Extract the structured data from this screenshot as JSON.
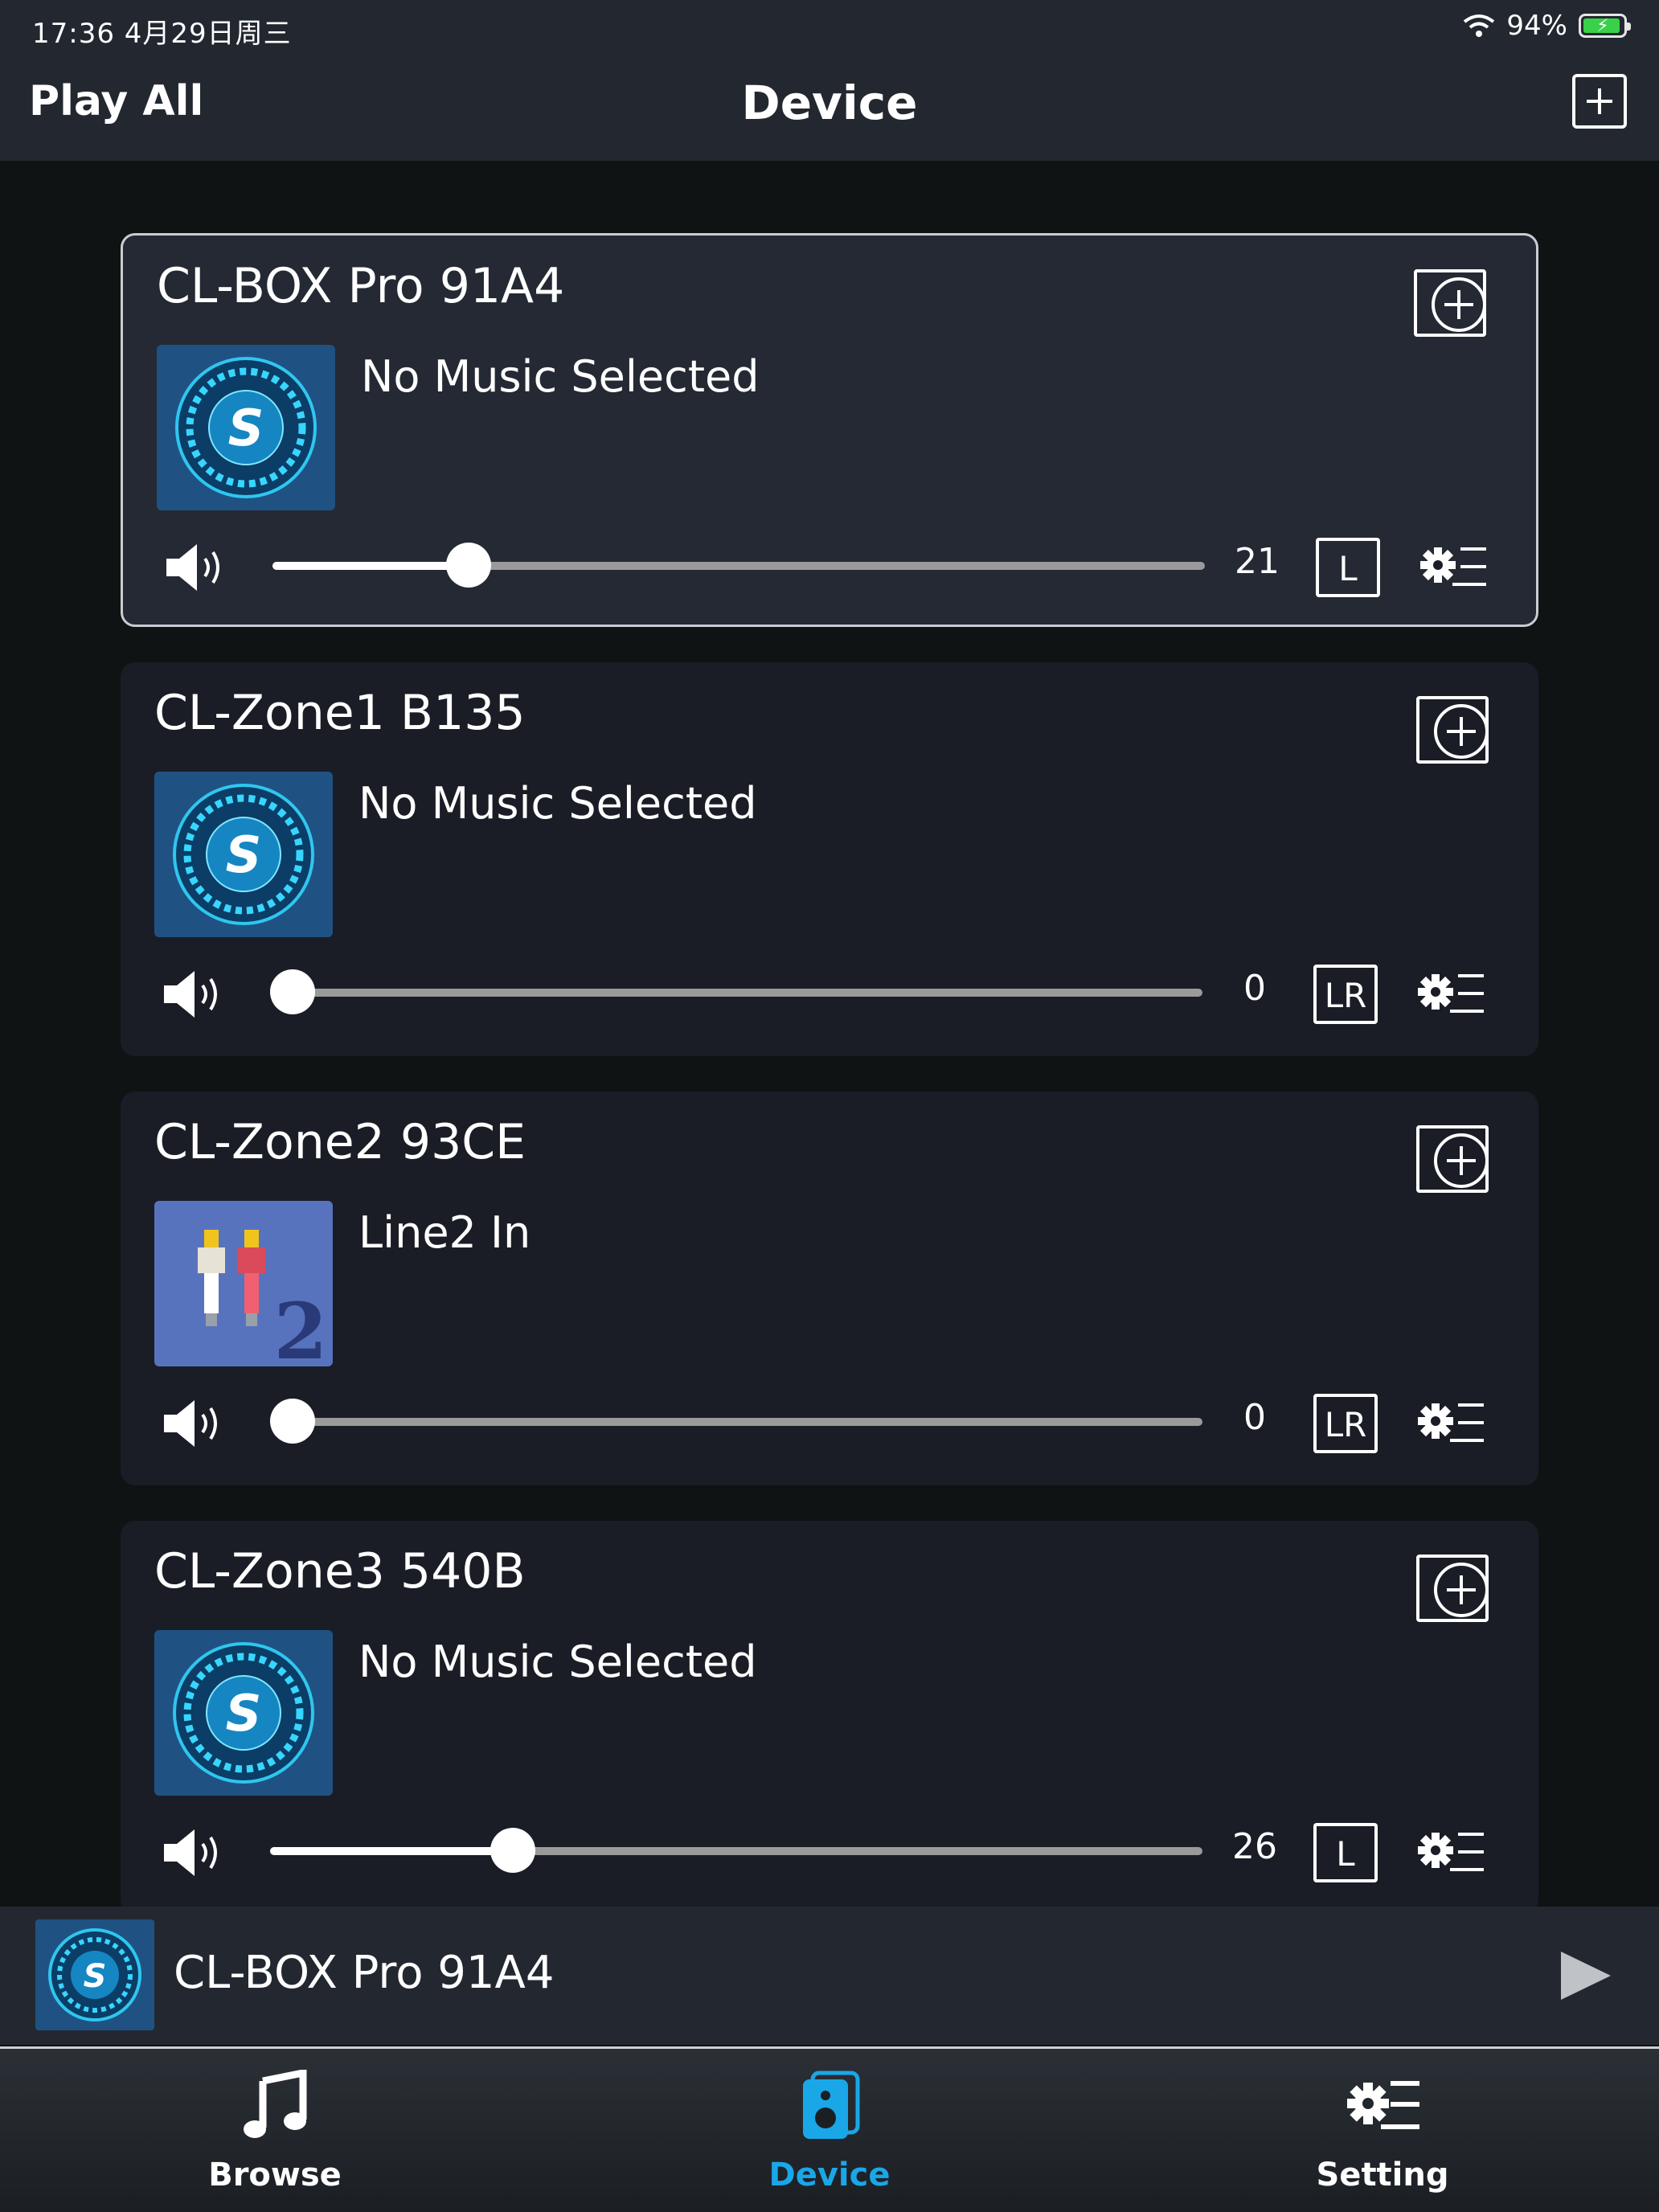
{
  "status_bar": {
    "time_date": "17:36   4月29日周三",
    "battery": "94%",
    "battery_level": 0.94
  },
  "nav": {
    "left_label": "Play All",
    "title": "Device"
  },
  "devices": [
    {
      "name": "CL-BOX Pro 91A4",
      "source": "No Music Selected",
      "cover": "app-logo",
      "volume": 21,
      "volume_fraction": 0.21,
      "channel": "L",
      "selected": true
    },
    {
      "name": "CL-Zone1 B135",
      "source": "No Music Selected",
      "cover": "app-logo",
      "volume": 0,
      "volume_fraction": 0.0,
      "channel": "LR",
      "selected": false
    },
    {
      "name": "CL-Zone2 93CE",
      "source": "Line2 In",
      "cover": "line-in-2",
      "volume": 0,
      "volume_fraction": 0.0,
      "channel": "LR",
      "selected": false
    },
    {
      "name": "CL-Zone3 540B",
      "source": "No Music Selected",
      "cover": "app-logo",
      "volume": 26,
      "volume_fraction": 0.26,
      "channel": "L",
      "selected": false
    }
  ],
  "mini_player": {
    "device_name": "CL-BOX Pro 91A4"
  },
  "tabs": [
    {
      "label": "Browse",
      "icon": "music-note-icon",
      "active": false
    },
    {
      "label": "Device",
      "icon": "speaker-icon",
      "active": true
    },
    {
      "label": "Setting",
      "icon": "gear-list-icon",
      "active": false
    }
  ],
  "colors": {
    "accent": "#1aa7e8",
    "background": "#0f1314",
    "card": "#1a1d25",
    "card_selected": "#242933",
    "bar": "#232830"
  }
}
